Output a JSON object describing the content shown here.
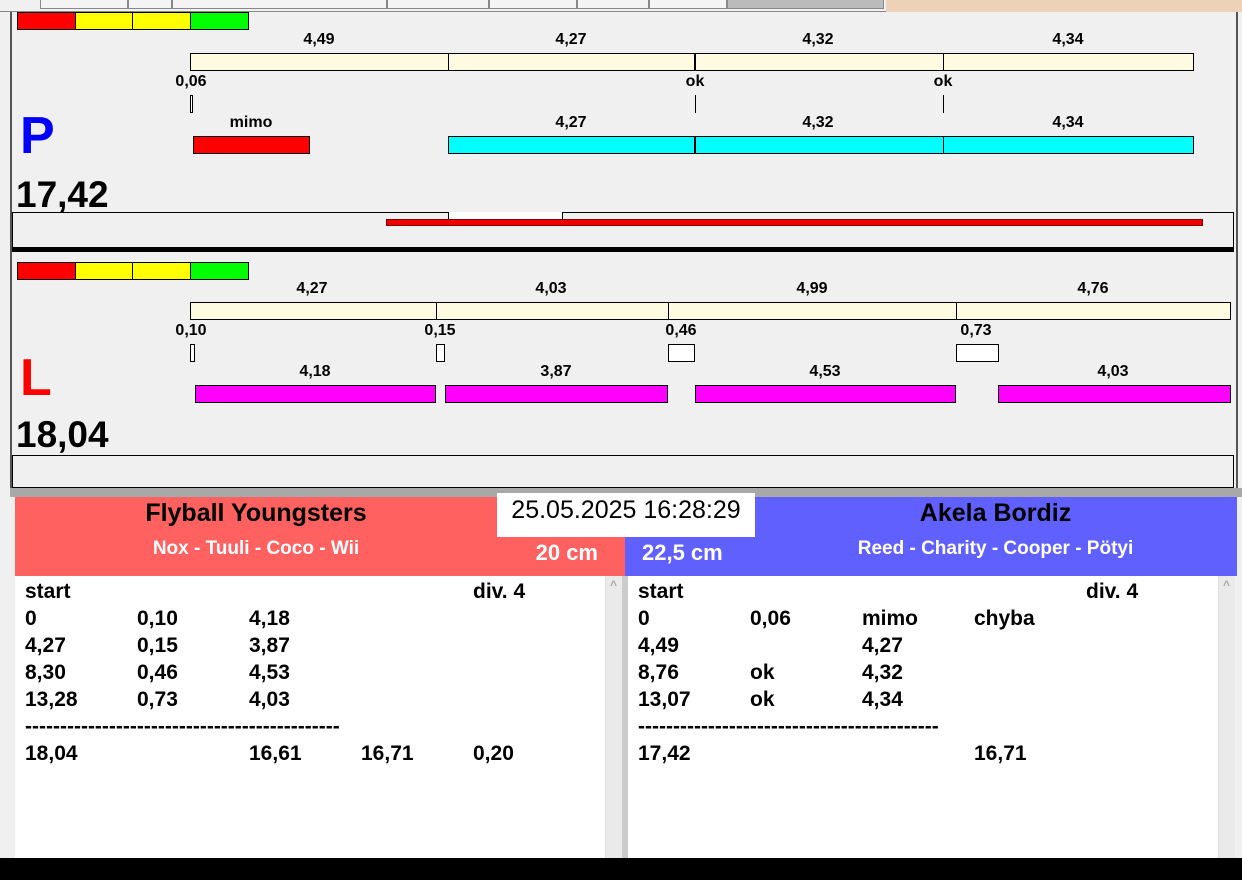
{
  "colors": {
    "red": "#ff0000",
    "yellow": "#ffff00",
    "green": "#00ff00",
    "cream": "#fffbe0",
    "cyan": "#00ffff",
    "magenta": "#ff00ff",
    "left_team": "#ff6060",
    "right_team": "#6060ff"
  },
  "lane_p": {
    "letter": "P",
    "total": "17,42",
    "split_labels": [
      "4,49",
      "4,27",
      "4,32",
      "4,34"
    ],
    "pass_labels": [
      "0,06",
      "ok",
      "ok"
    ],
    "run_labels": [
      "mimo",
      "4,27",
      "4,32",
      "4,34"
    ]
  },
  "lane_l": {
    "letter": "L",
    "total": "18,04",
    "split_labels": [
      "4,27",
      "4,03",
      "4,99",
      "4,76"
    ],
    "pass_labels": [
      "0,10",
      "0,15",
      "0,46",
      "0,73"
    ],
    "run_labels": [
      "4,18",
      "3,87",
      "4,53",
      "4,03"
    ]
  },
  "datetime": "25.05.2025 16:28:29",
  "left_team": {
    "name": "Flyball Youngsters",
    "dogs": "Nox - Tuuli - Coco - Wii",
    "height": "20 cm",
    "header": [
      "start",
      "div.  4"
    ],
    "rows": [
      [
        "0",
        "0,10",
        "4,18",
        "",
        ""
      ],
      [
        "4,27",
        "0,15",
        "3,87",
        "",
        ""
      ],
      [
        "8,30",
        "0,46",
        "4,53",
        "",
        ""
      ],
      [
        "13,28",
        "0,73",
        "4,03",
        "",
        ""
      ]
    ],
    "separator": "---------------------------------------------",
    "summary": [
      "18,04",
      "",
      "16,61",
      "16,71",
      "0,20"
    ]
  },
  "right_team": {
    "name": "Akela Bordiz",
    "dogs": "Reed - Charity - Cooper - Pötyi",
    "height": "22,5 cm",
    "header": [
      "start",
      "div.  4"
    ],
    "rows": [
      [
        "0",
        "0,06",
        "mimo",
        "chyba",
        ""
      ],
      [
        "4,49",
        "",
        "4,27",
        "",
        ""
      ],
      [
        "8,76",
        "ok",
        "4,32",
        "",
        ""
      ],
      [
        "13,07",
        "ok",
        "4,34",
        "",
        ""
      ]
    ],
    "separator": "-------------------------------------------",
    "summary": [
      "17,42",
      "",
      "",
      "16,71",
      ""
    ]
  }
}
